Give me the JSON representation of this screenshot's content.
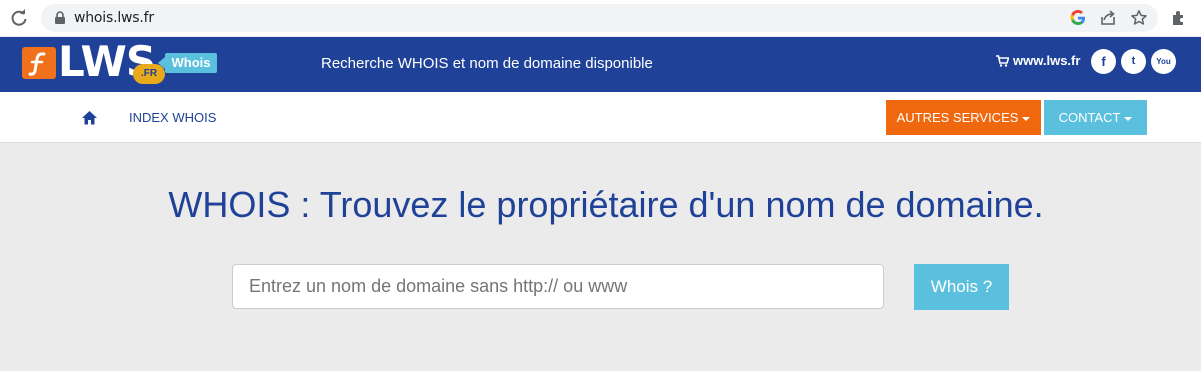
{
  "browser": {
    "url": "whois.lws.fr"
  },
  "header": {
    "logo_text": "LWS",
    "logo_fr": ".FR",
    "badge": "Whois",
    "tagline": "Recherche WHOIS et nom de domaine disponible",
    "site_link": "www.lws.fr",
    "social": [
      "f",
      "t",
      "You"
    ]
  },
  "nav": {
    "index_label": "INDEX WHOIS",
    "services_label": "AUTRES SERVICES",
    "contact_label": "CONTACT"
  },
  "main": {
    "title": "WHOIS : Trouvez le propriétaire d'un nom de domaine.",
    "search_placeholder": "Entrez un nom de domaine sans http:// ou www",
    "whois_button": "Whois ?"
  },
  "colors": {
    "brand_blue": "#1f4298",
    "orange": "#f0680d",
    "light_blue": "#5bc0de",
    "background": "#ebebeb"
  },
  "icons": [
    "reload-icon",
    "lock-icon",
    "google-icon",
    "share-icon",
    "star-icon",
    "extensions-icon",
    "home-icon",
    "cart-icon",
    "facebook-icon",
    "twitter-icon",
    "youtube-icon"
  ]
}
